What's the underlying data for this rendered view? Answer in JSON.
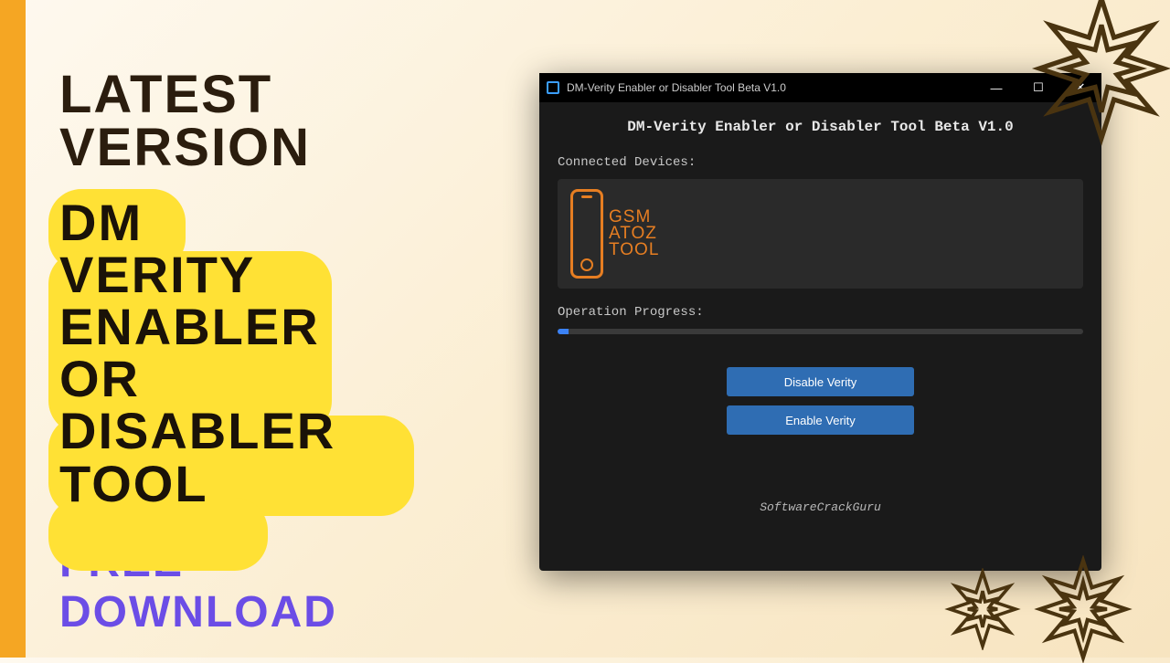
{
  "banner": {
    "heading": "LATEST VERSION",
    "title_lines": [
      "DM",
      "VERITY",
      "ENABLER",
      "OR",
      "DISABLER",
      "TOOL"
    ],
    "subtitle": "FREE DOWNLOAD"
  },
  "window": {
    "titlebar": "DM-Verity Enabler or Disabler Tool Beta V1.0",
    "app_title": "DM-Verity Enabler or Disabler Tool Beta V1.0",
    "connected_label": "Connected Devices:",
    "logo_lines": [
      "GSM",
      "ATOZ",
      "TOOL"
    ],
    "progress_label": "Operation Progress:",
    "disable_btn": "Disable Verity",
    "enable_btn": "Enable Verity",
    "footer": "SoftwareCrackGuru",
    "controls": {
      "minimize": "—",
      "maximize": "☐",
      "close": "✕"
    }
  }
}
